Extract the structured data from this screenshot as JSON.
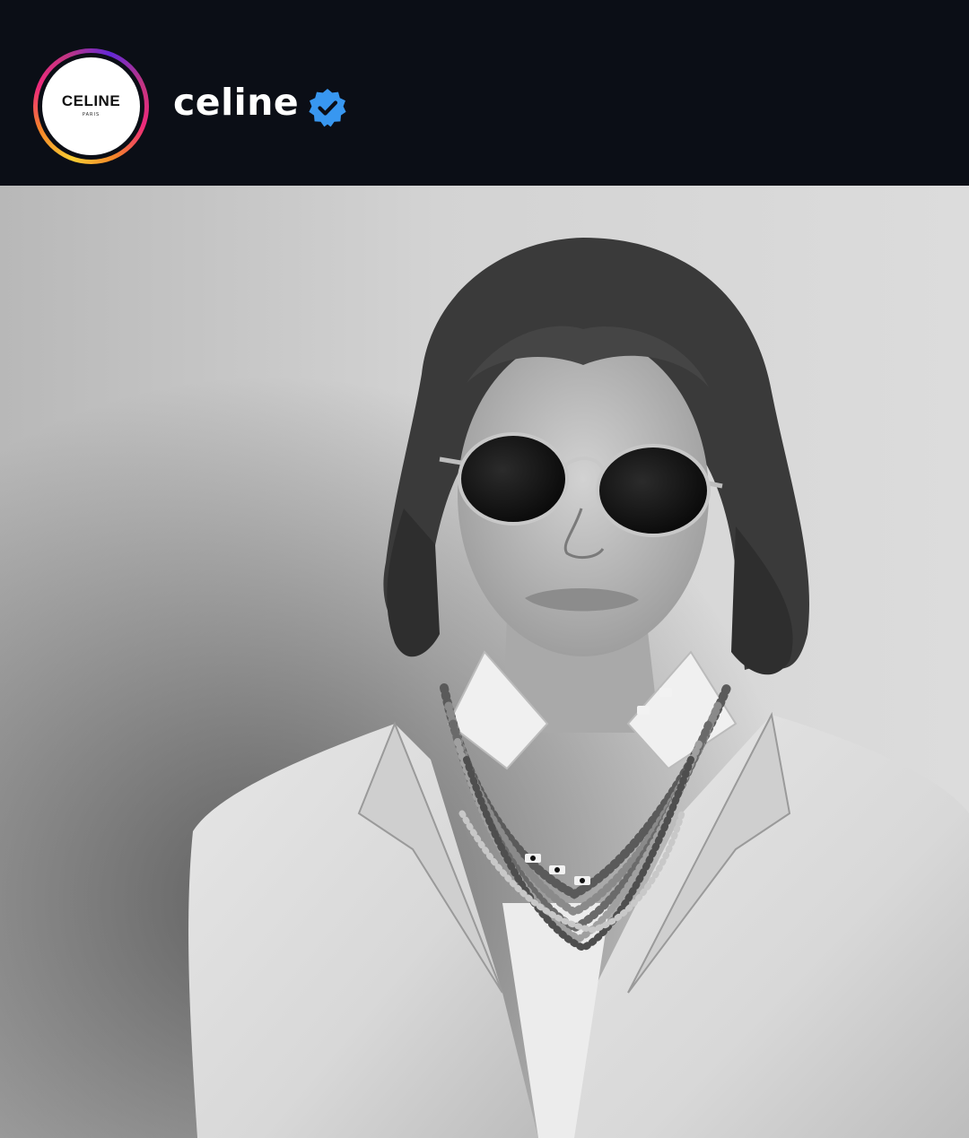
{
  "profile": {
    "username": "celine",
    "verified": true,
    "avatar_logo": {
      "wordmark": "CELINE",
      "subtitle": "PARIS"
    },
    "story_ring_colors": [
      "#f9ce34",
      "#ee2a7b",
      "#6228d7"
    ]
  },
  "post": {
    "media_type": "photo",
    "description_icon": "portrait-photo"
  },
  "colors": {
    "header_bg": "#0b0e16",
    "verified_badge": "#3897f0",
    "username_text": "#ffffff"
  }
}
